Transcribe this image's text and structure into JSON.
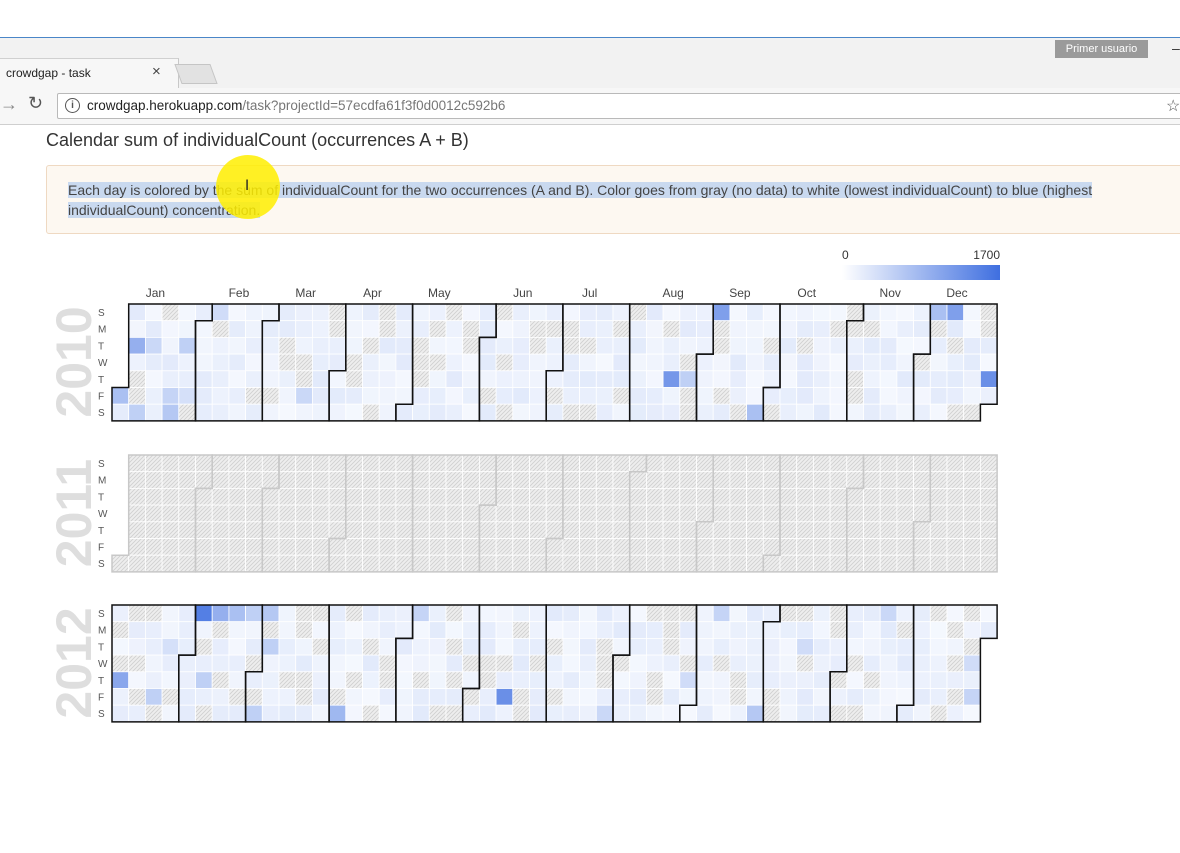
{
  "browser": {
    "tab_title": "crowdgap - task",
    "tab_close": "×",
    "user_badge": "Primer usuario",
    "minimize": "–",
    "url_host": "crowdgap.herokuapp.com",
    "url_path": "/task?projectId=57ecdfa61f3f0d0012c592b6",
    "back_icon": "→",
    "reload_icon": "↻",
    "star_icon": "☆"
  },
  "page": {
    "title": "Calendar sum of individualCount (occurrences A + B)",
    "description": "Each day is colored by the sum of individualCount for the two occurrences (A and B). Color goes from gray (no data) to white (lowest individualCount) to blue (highest individualCount) concentration."
  },
  "chart_data": {
    "type": "heatmap",
    "title": "",
    "legend": {
      "min": "0",
      "max": "1700",
      "low_color": "#ffffff",
      "high_color": "#3f6fe0",
      "placement": "top-right"
    },
    "colors": {
      "no_data": "#eeeeee",
      "low": "#f5f8fe",
      "high": "#3f6fe0"
    },
    "months": [
      "Jan",
      "Feb",
      "Mar",
      "Apr",
      "May",
      "Jun",
      "Jul",
      "Aug",
      "Sep",
      "Oct",
      "Nov",
      "Dec"
    ],
    "day_labels": [
      "S",
      "M",
      "T",
      "W",
      "T",
      "F",
      "S"
    ],
    "years": [
      {
        "year": "2010",
        "no_data_fraction": 0.2,
        "highlights": [
          {
            "date": "2010-01-01",
            "value": 700
          },
          {
            "date": "2010-01-05",
            "value": 900
          },
          {
            "date": "2010-01-09",
            "value": 500
          },
          {
            "date": "2010-01-12",
            "value": 400
          },
          {
            "date": "2010-01-22",
            "value": 450
          },
          {
            "date": "2010-01-23",
            "value": 600
          },
          {
            "date": "2010-01-26",
            "value": 500
          },
          {
            "date": "2010-01-29",
            "value": 300
          },
          {
            "date": "2010-02-07",
            "value": 350
          },
          {
            "date": "2010-03-19",
            "value": 400
          },
          {
            "date": "2010-08-19",
            "value": 1200
          },
          {
            "date": "2010-08-26",
            "value": 500
          },
          {
            "date": "2010-09-05",
            "value": 1100
          },
          {
            "date": "2010-09-25",
            "value": 700
          },
          {
            "date": "2010-12-05",
            "value": 700
          },
          {
            "date": "2010-12-12",
            "value": 1100
          },
          {
            "date": "2010-12-30",
            "value": 1300
          }
        ]
      },
      {
        "year": "2011",
        "no_data_fraction": 1.0,
        "highlights": []
      },
      {
        "year": "2012",
        "no_data_fraction": 0.25,
        "highlights": [
          {
            "date": "2012-01-05",
            "value": 1000
          },
          {
            "date": "2012-01-20",
            "value": 500
          },
          {
            "date": "2012-01-24",
            "value": 300
          },
          {
            "date": "2012-02-05",
            "value": 1500
          },
          {
            "date": "2012-02-12",
            "value": 900
          },
          {
            "date": "2012-02-09",
            "value": 500
          },
          {
            "date": "2012-02-19",
            "value": 700
          },
          {
            "date": "2012-02-26",
            "value": 500
          },
          {
            "date": "2012-03-03",
            "value": 500
          },
          {
            "date": "2012-03-04",
            "value": 600
          },
          {
            "date": "2012-03-06",
            "value": 500
          },
          {
            "date": "2012-04-07",
            "value": 800
          },
          {
            "date": "2012-05-06",
            "value": 450
          },
          {
            "date": "2012-06-15",
            "value": 1300
          },
          {
            "date": "2012-07-28",
            "value": 400
          },
          {
            "date": "2012-08-30",
            "value": 350
          },
          {
            "date": "2012-09-09",
            "value": 450
          },
          {
            "date": "2012-09-29",
            "value": 600
          },
          {
            "date": "2012-10-16",
            "value": 350
          },
          {
            "date": "2012-11-18",
            "value": 400
          },
          {
            "date": "2012-12-28",
            "value": 450
          },
          {
            "date": "2012-12-26",
            "value": 350
          }
        ]
      }
    ]
  }
}
